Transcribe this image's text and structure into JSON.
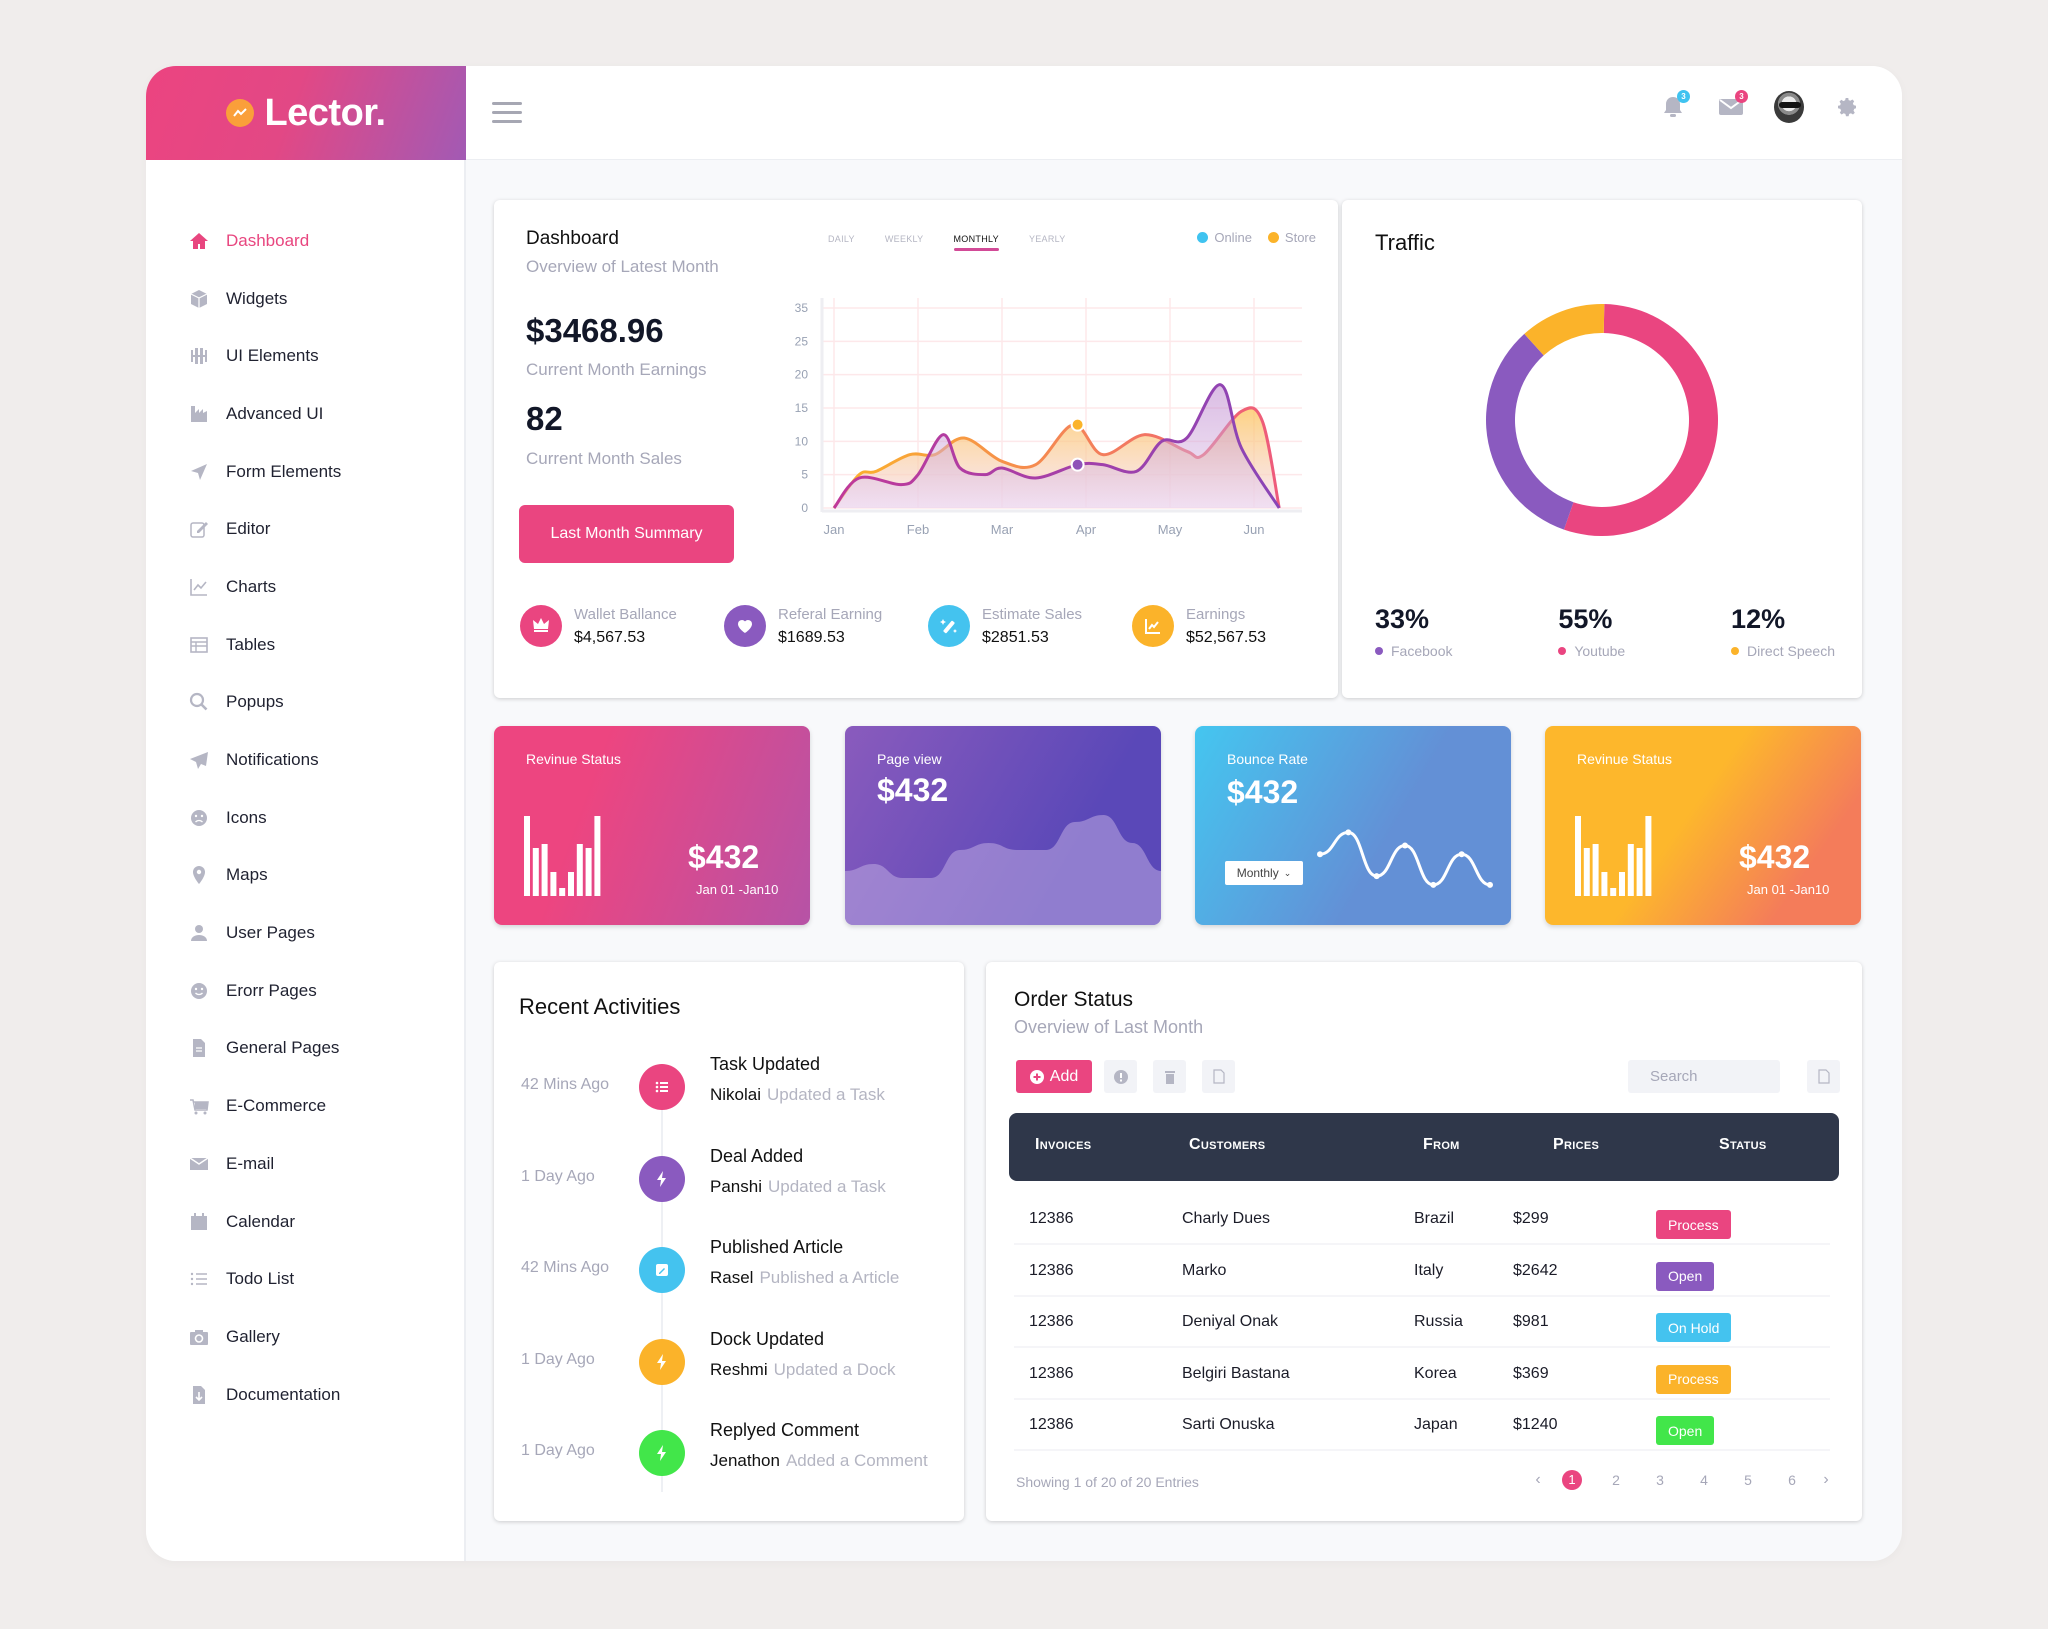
{
  "brand": {
    "name": "Lector.",
    "logo_icon": "trend-icon"
  },
  "topbar": {
    "menu_icon": "hamburger-icon",
    "notifications": {
      "icon": "bell-icon",
      "count": "3",
      "badge_color": "#3fc3f0"
    },
    "messages": {
      "icon": "mail-icon",
      "count": "3",
      "badge_color": "#ea4580"
    },
    "avatar": "user-avatar",
    "settings_icon": "gear-icon"
  },
  "sidebar": {
    "items": [
      {
        "label": "Dashboard",
        "icon": "home-icon",
        "active": true
      },
      {
        "label": "Widgets",
        "icon": "cube-icon"
      },
      {
        "label": "UI Elements",
        "icon": "sliders-icon"
      },
      {
        "label": "Advanced UI",
        "icon": "factory-chart-icon"
      },
      {
        "label": "Form Elements",
        "icon": "navigation-icon"
      },
      {
        "label": "Editor",
        "icon": "edit-icon"
      },
      {
        "label": "Charts",
        "icon": "line-chart-icon"
      },
      {
        "label": "Tables",
        "icon": "table-icon"
      },
      {
        "label": "Popups",
        "icon": "search-icon"
      },
      {
        "label": "Notifications",
        "icon": "paper-plane-icon"
      },
      {
        "label": "Icons",
        "icon": "sad-face-icon"
      },
      {
        "label": "Maps",
        "icon": "map-pin-icon"
      },
      {
        "label": "User Pages",
        "icon": "user-icon"
      },
      {
        "label": "Erorr Pages",
        "icon": "smile-face-icon"
      },
      {
        "label": "General Pages",
        "icon": "file-icon"
      },
      {
        "label": "E-Commerce",
        "icon": "cart-icon"
      },
      {
        "label": "E-mail",
        "icon": "envelope-icon"
      },
      {
        "label": "Calendar",
        "icon": "calendar-icon"
      },
      {
        "label": "Todo List",
        "icon": "list-icon"
      },
      {
        "label": "Gallery",
        "icon": "camera-icon"
      },
      {
        "label": "Documentation",
        "icon": "download-file-icon"
      }
    ]
  },
  "dashboard": {
    "title": "Dashboard",
    "subtitle": "Overview of Latest Month",
    "earnings_value": "$3468.96",
    "earnings_label": "Current Month Earnings",
    "sales_value": "82",
    "sales_label": "Current Month Sales",
    "summary_button": "Last Month Summary",
    "tabs": [
      {
        "label": "Daily"
      },
      {
        "label": "Weekly"
      },
      {
        "label": "Monthly",
        "active": true
      },
      {
        "label": "Yearly"
      }
    ],
    "legend": [
      {
        "label": "Online",
        "color": "#3fc3f0"
      },
      {
        "label": "Store",
        "color": "#fbb32a"
      }
    ],
    "mini_stats": [
      {
        "label": "Wallet Ballance",
        "value": "$4,567.53",
        "icon": "crown-icon",
        "color": "#ea4580"
      },
      {
        "label": "Referal Earning",
        "value": "$1689.53",
        "icon": "heart-icon",
        "color": "#8a5abf"
      },
      {
        "label": "Estimate Sales",
        "value": "$2851.53",
        "icon": "magic-wand-icon",
        "color": "#44c3ef"
      },
      {
        "label": "Earnings",
        "value": "$52,567.53",
        "icon": "chart-up-icon",
        "color": "#fbb32a"
      }
    ]
  },
  "chart_data": [
    {
      "type": "area",
      "title": "Dashboard",
      "x": [
        "Jan",
        "Feb",
        "Mar",
        "Apr",
        "May",
        "Jun"
      ],
      "xlabel": "",
      "ylabel": "",
      "y_ticks": [
        0,
        5,
        10,
        15,
        20,
        25,
        35
      ],
      "ylim": [
        0,
        35
      ],
      "grid": true,
      "series": [
        {
          "name": "Store",
          "color": "#fbb32a",
          "x": [
            0,
            0.3,
            0.5,
            0.9,
            1.2,
            1.55,
            2.0,
            2.4,
            2.85,
            3.2,
            3.7,
            4.2,
            4.4,
            4.85,
            5.1,
            5.3
          ],
          "values": [
            0,
            5,
            5.5,
            8,
            8,
            10.5,
            7,
            6.5,
            12.5,
            8,
            11,
            8.5,
            8,
            14.5,
            13,
            0
          ]
        },
        {
          "name": "Online",
          "color": "#9c3fb4",
          "x": [
            0,
            0.3,
            0.8,
            1.0,
            1.3,
            1.5,
            1.8,
            2.0,
            2.4,
            2.9,
            3.2,
            3.6,
            3.9,
            4.2,
            4.6,
            4.85,
            5.3
          ],
          "values": [
            0,
            4.5,
            3.5,
            5,
            11,
            6,
            5,
            6,
            4.5,
            6.5,
            6.5,
            5.5,
            10,
            10.5,
            18.5,
            9,
            0
          ]
        }
      ],
      "markers": [
        {
          "series": "Store",
          "x": 2.9,
          "y": 12.5
        },
        {
          "series": "Online",
          "x": 2.9,
          "y": 6.5
        }
      ]
    },
    {
      "type": "pie",
      "title": "Traffic",
      "donut": true,
      "slices": [
        {
          "label": "Youtube",
          "value": 55,
          "color": "#ea4580"
        },
        {
          "label": "Facebook",
          "value": 33,
          "color": "#8a5abf"
        },
        {
          "label": "Direct Speech",
          "value": 12,
          "color": "#fbb32a"
        }
      ]
    },
    {
      "type": "bar",
      "title": "Revinue Status",
      "values": [
        10,
        6,
        6.5,
        3,
        1,
        3,
        6.5,
        6,
        10
      ],
      "ylim": [
        0,
        10
      ]
    },
    {
      "type": "area",
      "title": "Page view",
      "values": [
        3,
        3.5,
        2.5,
        2.5,
        4.5,
        5,
        4.5,
        4.5,
        6.5,
        7,
        5,
        3
      ]
    },
    {
      "type": "line",
      "title": "Bounce Rate",
      "values": [
        5,
        7.5,
        2.5,
        6,
        1.5,
        5,
        1.5
      ],
      "markers": true
    }
  ],
  "traffic": {
    "title": "Traffic",
    "stats": [
      {
        "value": "33%",
        "label": "Facebook",
        "color": "#8a5abf"
      },
      {
        "value": "55%",
        "label": "Youtube",
        "color": "#ea4580"
      },
      {
        "value": "12%",
        "label": "Direct Speech",
        "color": "#fbb32a"
      }
    ]
  },
  "color_cards": [
    {
      "title": "Revinue Status",
      "value": "$432",
      "date": "Jan 01 -Jan10"
    },
    {
      "title": "Page view",
      "value": "$432"
    },
    {
      "title": "Bounce Rate",
      "value": "$432",
      "select": "Monthly"
    },
    {
      "title": "Revinue Status",
      "value": "$432",
      "date": "Jan 01 -Jan10"
    }
  ],
  "activities": {
    "title": "Recent Activities",
    "items": [
      {
        "time": "42 Mins Ago",
        "title": "Task Updated",
        "user": "Nikolai",
        "action": "Updated a Task",
        "icon": "list-icon",
        "color": "#ea4580"
      },
      {
        "time": "1 Day Ago",
        "title": "Deal Added",
        "user": "Panshi",
        "action": "Updated a Task",
        "icon": "bolt-icon",
        "color": "#8a5abf"
      },
      {
        "time": "42 Mins Ago",
        "title": "Published Article",
        "user": "Rasel",
        "action": "Published a Article",
        "icon": "edit-icon",
        "color": "#44c3ef"
      },
      {
        "time": "1 Day Ago",
        "title": "Dock Updated",
        "user": "Reshmi",
        "action": "Updated a Dock",
        "icon": "bolt-icon",
        "color": "#fbb32a"
      },
      {
        "time": "1 Day Ago",
        "title": "Replyed Comment",
        "user": "Jenathon",
        "action": "Added a Comment",
        "icon": "bolt-icon",
        "color": "#42e64a"
      }
    ]
  },
  "orders": {
    "title": "Order Status",
    "subtitle": "Overview of Last Month",
    "add_label": "Add",
    "search_placeholder": "Search",
    "columns": [
      "Invoices",
      "Customers",
      "From",
      "Prices",
      "Status"
    ],
    "rows": [
      {
        "invoice": "12386",
        "customer": "Charly Dues",
        "from": "Brazil",
        "price": "$299",
        "status": "Process",
        "status_color": "#ea4580"
      },
      {
        "invoice": "12386",
        "customer": "Marko",
        "from": "Italy",
        "price": "$2642",
        "status": "Open",
        "status_color": "#8a5abf"
      },
      {
        "invoice": "12386",
        "customer": "Deniyal Onak",
        "from": "Russia",
        "price": "$981",
        "status": "On Hold",
        "status_color": "#44c3ef"
      },
      {
        "invoice": "12386",
        "customer": "Belgiri Bastana",
        "from": "Korea",
        "price": "$369",
        "status": "Process",
        "status_color": "#fbb32a"
      },
      {
        "invoice": "12386",
        "customer": "Sarti Onuska",
        "from": "Japan",
        "price": "$1240",
        "status": "Open",
        "status_color": "#42e64a"
      }
    ],
    "footer": "Showing 1 of 20 of 20 Entries",
    "pages": [
      "1",
      "2",
      "3",
      "4",
      "5",
      "6"
    ],
    "current_page": "1"
  }
}
